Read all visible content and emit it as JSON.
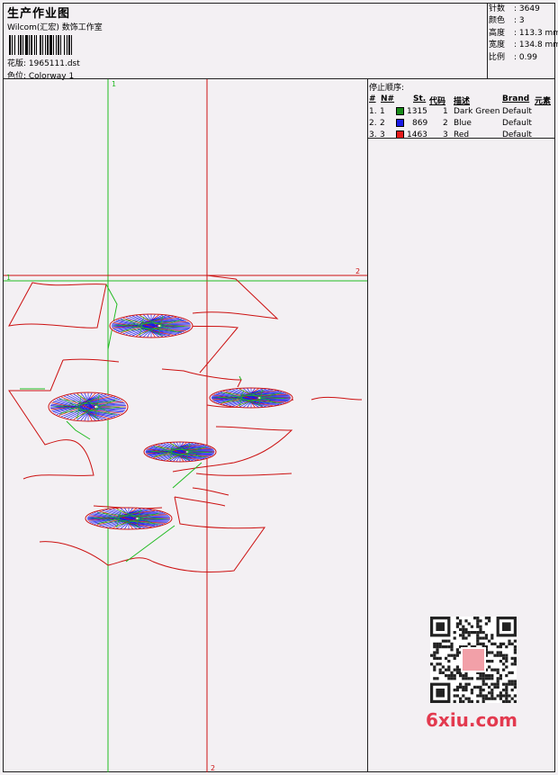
{
  "header": {
    "title": "生产作业图",
    "studio": "Wilcom(汇宏) 数饰工作室",
    "design_file": "花版:  1965111.dst",
    "colorway": "色位:  Colorway 1"
  },
  "stats": [
    {
      "label": "针数",
      "value": "3649"
    },
    {
      "label": "颜色",
      "value": "3"
    },
    {
      "label": "高度",
      "value": "113.3 mm"
    },
    {
      "label": "宽度",
      "value": "134.8 mm"
    },
    {
      "label": "比例",
      "value": "0.99"
    }
  ],
  "stop_sequence": {
    "title": "停止顺序:",
    "headers": {
      "num": "#",
      "no": "N#",
      "stitches": "St.",
      "code": "代码",
      "desc": "描述",
      "brand": "Brand",
      "element": "元素"
    },
    "rows": [
      {
        "num": "1.",
        "no": "1",
        "color": "#1a8c1a",
        "stitches": "1315",
        "code": "1",
        "desc": "Dark Green",
        "brand": "Default"
      },
      {
        "num": "2.",
        "no": "2",
        "color": "#1a1ae6",
        "stitches": "869",
        "code": "2",
        "desc": "Blue",
        "brand": "Default"
      },
      {
        "num": "3.",
        "no": "3",
        "color": "#e61a1a",
        "stitches": "1463",
        "code": "3",
        "desc": "Red",
        "brand": "Default"
      }
    ]
  },
  "guides": {
    "v1_label": "1",
    "v2_label": "2",
    "h1_label": "1",
    "h2_label": "2"
  },
  "colors": {
    "green": "#22bb22",
    "red": "#cc1111",
    "blue": "#1a1ae6"
  },
  "watermark": {
    "brand": "6xiu.com",
    "stamp_icon": "qr-code-icon"
  }
}
